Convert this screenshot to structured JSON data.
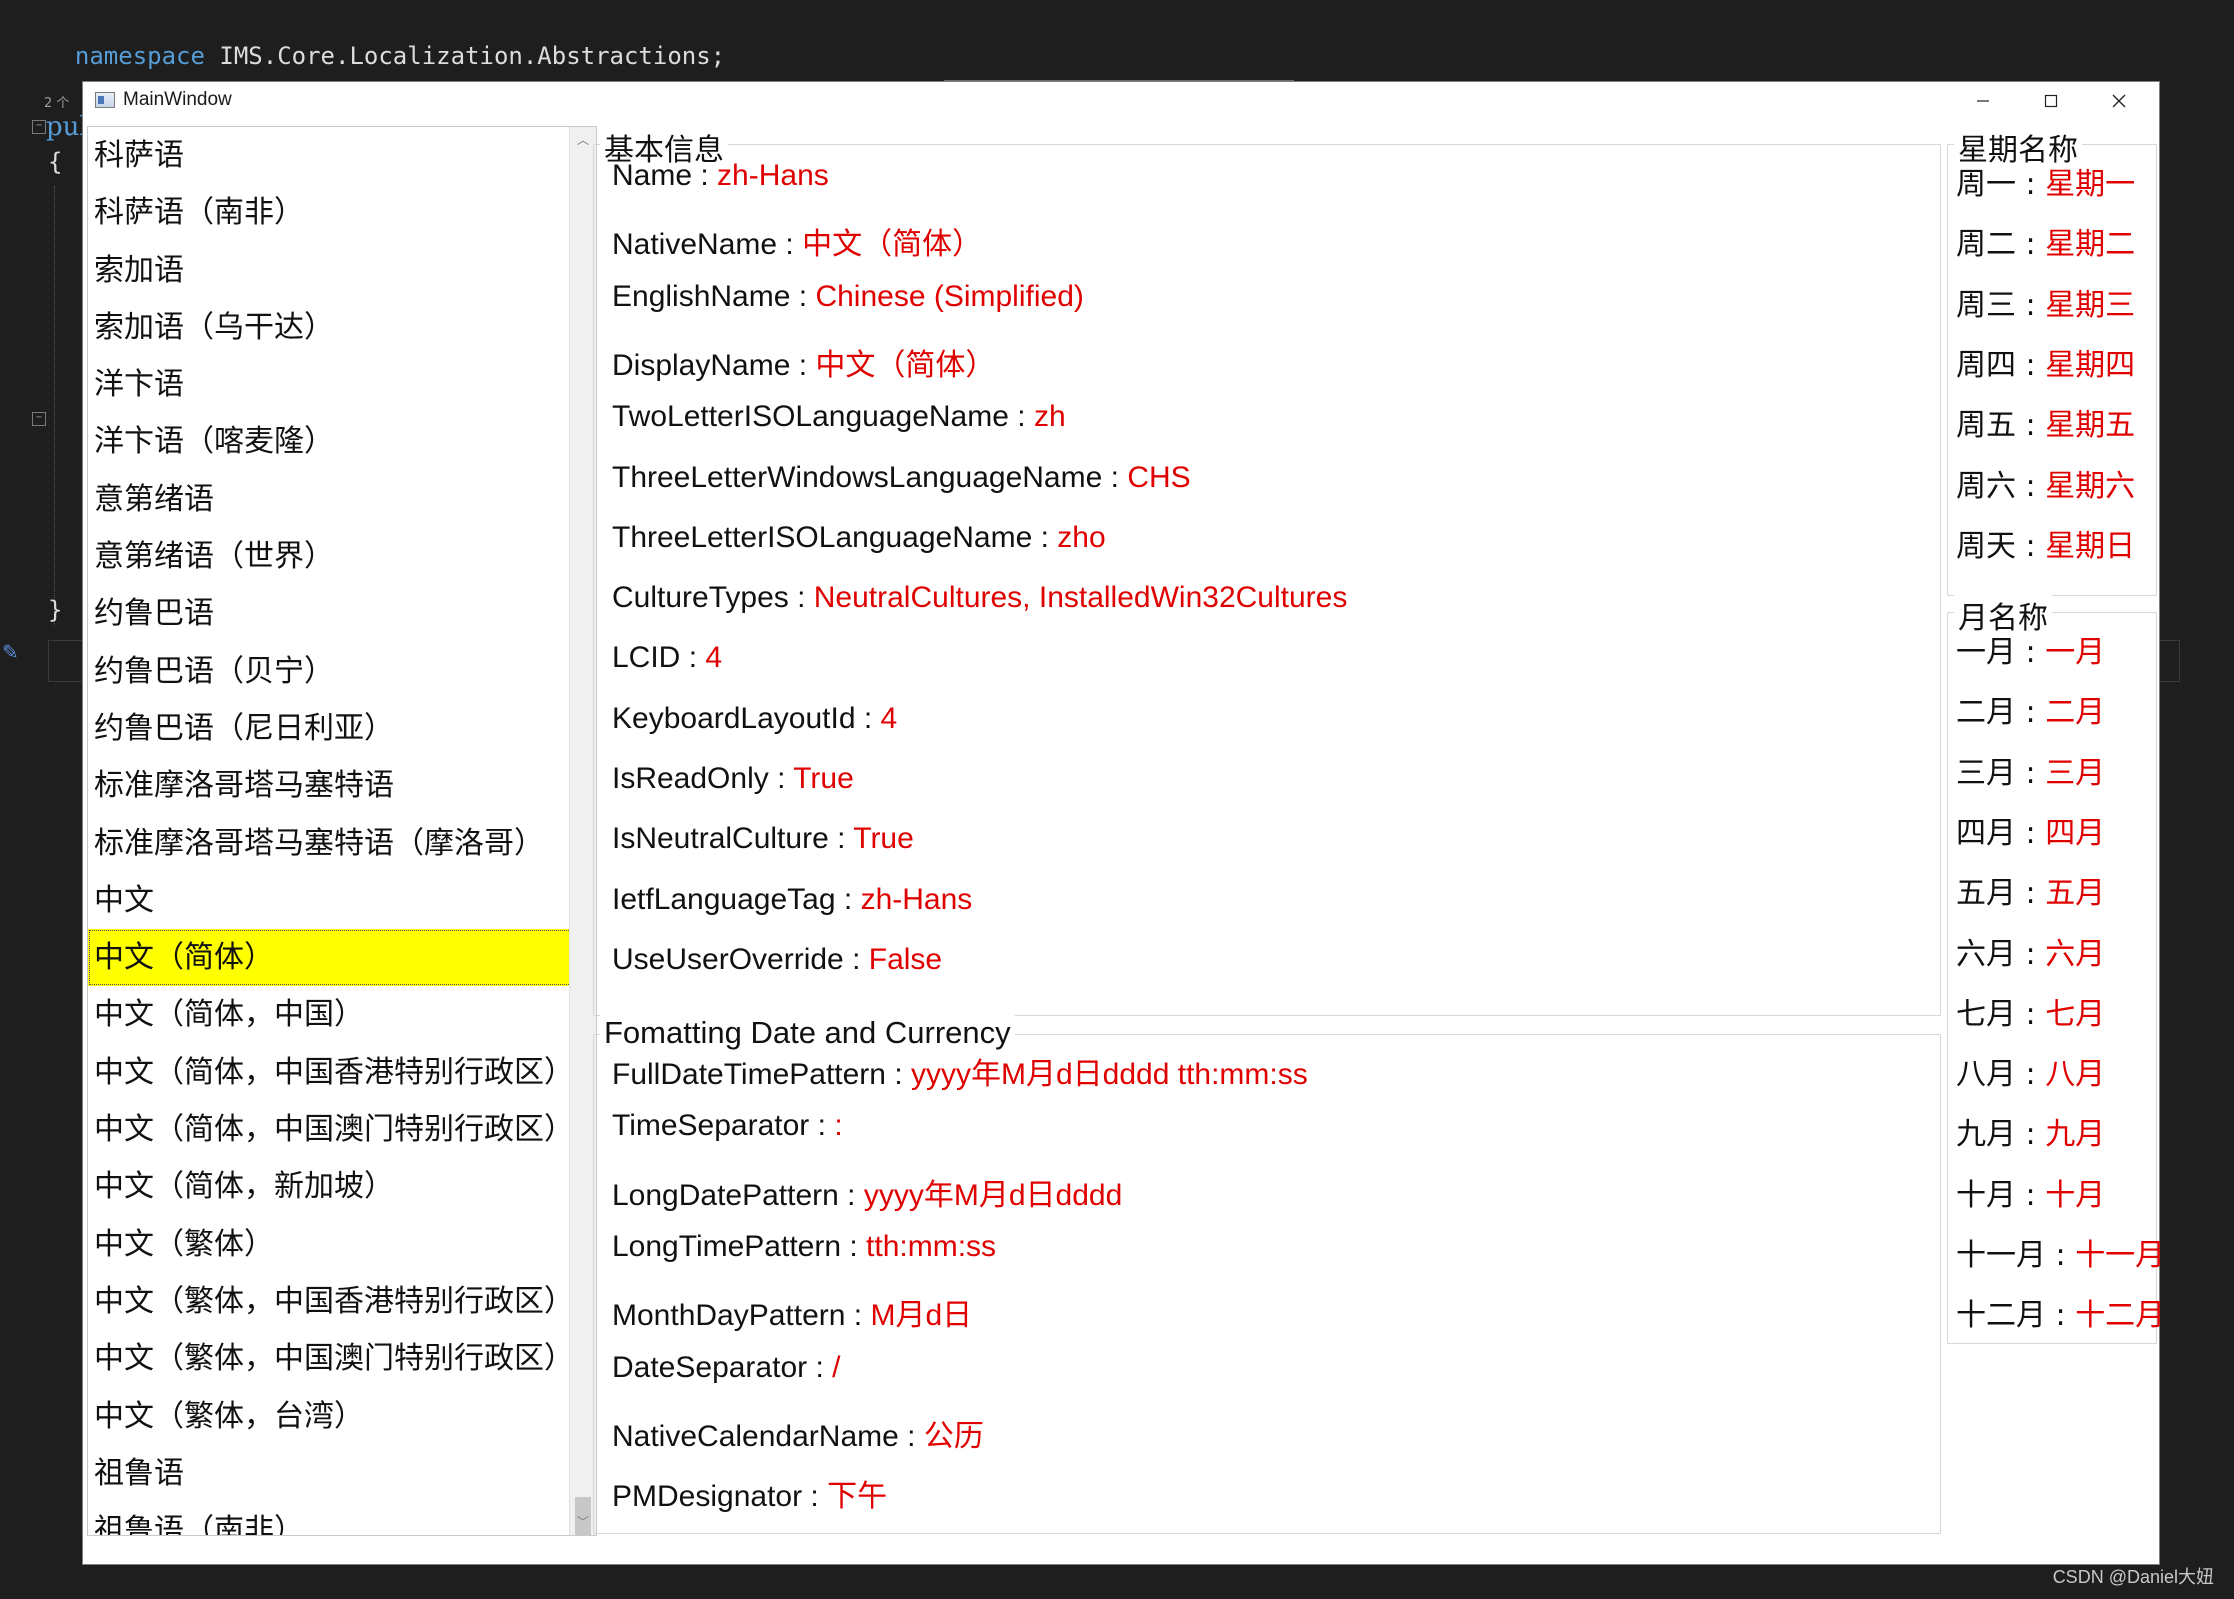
{
  "editor": {
    "namespace_keyword": "namespace",
    "namespace_name": "IMS.Core.Localization.Abstractions;",
    "ref_count": "2 个",
    "pub_fragment": "pul",
    "open_brace": "{",
    "close_brace": "}"
  },
  "watermark": "CSDN @Daniel大妞",
  "window": {
    "title": "MainWindow",
    "controls": [
      "minimize-icon",
      "maximize-icon",
      "close-icon"
    ]
  },
  "debug_toolbar_icons": [
    "live-tree-icon",
    "record-icon",
    "select-element-icon",
    "display-adorners-icon",
    "track-focus-icon",
    "hot-reload-icon",
    "check-icon",
    "collapse-chevron-icon"
  ],
  "culture_list": {
    "items": [
      "科萨语",
      "科萨语（南非）",
      "索加语",
      "索加语（乌干达）",
      "洋卞语",
      "洋卞语（喀麦隆）",
      "意第绪语",
      "意第绪语（世界）",
      "约鲁巴语",
      "约鲁巴语（贝宁）",
      "约鲁巴语（尼日利亚）",
      "标准摩洛哥塔马塞特语",
      "标准摩洛哥塔马塞特语（摩洛哥）",
      "中文",
      "中文（简体）",
      "中文（简体，中国）",
      "中文（简体，中国香港特别行政区）",
      "中文（简体，中国澳门特别行政区）",
      "中文（简体，新加坡）",
      "中文（繁体）",
      "中文（繁体，中国香港特别行政区）",
      "中文（繁体，中国澳门特别行政区）",
      "中文（繁体，台湾）",
      "祖鲁语",
      "祖鲁语（南非）"
    ],
    "selected_index": 14
  },
  "basic_info": {
    "header": "基本信息",
    "rows": [
      {
        "label": "Name",
        "value": "zh-Hans"
      },
      {
        "label": "NativeName",
        "value": "中文（简体）"
      },
      {
        "label": "EnglishName",
        "value": "Chinese (Simplified)"
      },
      {
        "label": "DisplayName",
        "value": "中文（简体）"
      },
      {
        "label": "TwoLetterISOLanguageName",
        "value": "zh"
      },
      {
        "label": "ThreeLetterWindowsLanguageName",
        "value": "CHS"
      },
      {
        "label": "ThreeLetterISOLanguageName",
        "value": "zho"
      },
      {
        "label": "CultureTypes",
        "value": "NeutralCultures, InstalledWin32Cultures"
      },
      {
        "label": "LCID",
        "value": "4"
      },
      {
        "label": "KeyboardLayoutId",
        "value": "4"
      },
      {
        "label": "IsReadOnly",
        "value": "True"
      },
      {
        "label": "IsNeutralCulture",
        "value": "True"
      },
      {
        "label": "IetfLanguageTag",
        "value": "zh-Hans"
      },
      {
        "label": "UseUserOverride",
        "value": "False"
      }
    ]
  },
  "formatting": {
    "header": "Fomatting Date and Currency",
    "rows": [
      {
        "label": "FullDateTimePattern",
        "value": "yyyy年M月d日dddd tth:mm:ss"
      },
      {
        "label": "TimeSeparator",
        "value": ":"
      },
      {
        "label": "LongDatePattern",
        "value": "yyyy年M月d日dddd"
      },
      {
        "label": "LongTimePattern",
        "value": "tth:mm:ss"
      },
      {
        "label": "MonthDayPattern",
        "value": "M月d日"
      },
      {
        "label": "DateSeparator",
        "value": "/"
      },
      {
        "label": "NativeCalendarName",
        "value": "公历"
      },
      {
        "label": "PMDesignator",
        "value": "下午"
      }
    ]
  },
  "day_names": {
    "header": "星期名称",
    "rows": [
      {
        "label": "周一",
        "value": "星期一"
      },
      {
        "label": "周二",
        "value": "星期二"
      },
      {
        "label": "周三",
        "value": "星期三"
      },
      {
        "label": "周四",
        "value": "星期四"
      },
      {
        "label": "周五",
        "value": "星期五"
      },
      {
        "label": "周六",
        "value": "星期六"
      },
      {
        "label": "周天",
        "value": "星期日"
      }
    ]
  },
  "month_names": {
    "header": "月名称",
    "rows": [
      {
        "label": "一月",
        "value": "一月"
      },
      {
        "label": "二月",
        "value": "二月"
      },
      {
        "label": "三月",
        "value": "三月"
      },
      {
        "label": "四月",
        "value": "四月"
      },
      {
        "label": "五月",
        "value": "五月"
      },
      {
        "label": "六月",
        "value": "六月"
      },
      {
        "label": "七月",
        "value": "七月"
      },
      {
        "label": "八月",
        "value": "八月"
      },
      {
        "label": "九月",
        "value": "九月"
      },
      {
        "label": "十月",
        "value": "十月"
      },
      {
        "label": "十一月",
        "value": "十一月"
      },
      {
        "label": "十二月",
        "value": "十二月"
      }
    ]
  },
  "separator": " : ",
  "colors": {
    "value": "#e00000",
    "selection": "#ffff00",
    "editor_bg": "#1e1e1e",
    "keyword": "#569cd6"
  }
}
